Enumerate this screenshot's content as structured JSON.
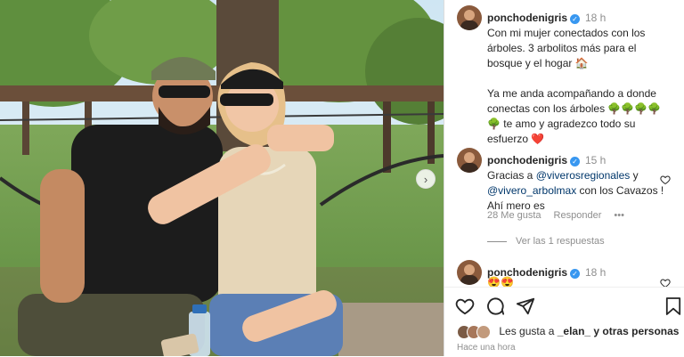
{
  "post": {
    "image_alt": "Pareja sentada en un tronco en un parque"
  },
  "comments": [
    {
      "user": "ponchodenigris",
      "time": "18 h",
      "paragraph1": "Con mi mujer conectados con los árboles. 3 arbolitos más para el bosque y el hogar 🏠",
      "paragraph2": "Ya me anda acompañando a donde conectas con los árboles 🌳🌳🌳🌳🌳 te amo y agradezco todo su esfuerzo ❤️"
    },
    {
      "user": "ponchodenigris",
      "time": "15 h",
      "text_before": "Gracias a ",
      "mention1": "@viverosregionales",
      "text_mid": " y ",
      "mention2": "@vivero_arbolmax",
      "text_after": " con los Cavazos ! Ahí mero es",
      "likes": "28 Me gusta",
      "reply": "Responder",
      "more": "•••",
      "view_replies": "Ver las 1 respuestas"
    },
    {
      "user": "ponchodenigris",
      "time": "18 h",
      "text": "😍😍"
    }
  ],
  "actions": {
    "liked_by_prefix": "Les gusta a ",
    "liked_by_user": "_elan_",
    "liked_by_suffix": " y otras personas",
    "posted_ago": "Hace una hora"
  },
  "colors": {
    "verified": "#3897f0",
    "mention": "#00376b",
    "secondary_text": "#8e8e8e",
    "heart_red": "#ed4956"
  }
}
